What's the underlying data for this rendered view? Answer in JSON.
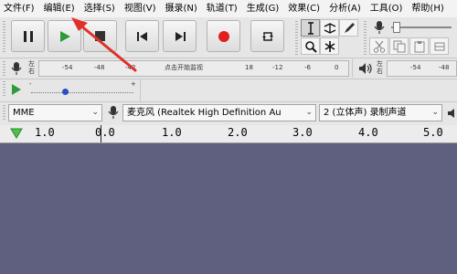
{
  "menu": [
    "文件(F)",
    "编辑(E)",
    "选择(S)",
    "视图(V)",
    "摄录(N)",
    "轨道(T)",
    "生成(G)",
    "效果(C)",
    "分析(A)",
    "工具(O)",
    "帮助(H)"
  ],
  "meter": {
    "left_label": "左",
    "right_label": "右",
    "record_scale": [
      "-54",
      "-48",
      "-42"
    ],
    "record_prompt": "点击开始监视",
    "record_scale_after": [
      "18",
      "-12",
      "-6",
      "0"
    ],
    "playback_scale": [
      "-54",
      "-48"
    ],
    "slider_minus": "-",
    "slider_plus": "+"
  },
  "device": {
    "host": "MME",
    "recording_device": "麦克风 (Realtek High Definition Au",
    "channels": "2 (立体声) 录制声道"
  },
  "timeline": {
    "labels": [
      "1.0",
      "0.0",
      "1.0",
      "2.0",
      "3.0",
      "4.0",
      "5.0"
    ]
  },
  "colors": {
    "track_background": "#5f5f80",
    "play_green": "#2f9a3a",
    "record_red": "#e02020",
    "arrow_red": "#e0302a"
  }
}
